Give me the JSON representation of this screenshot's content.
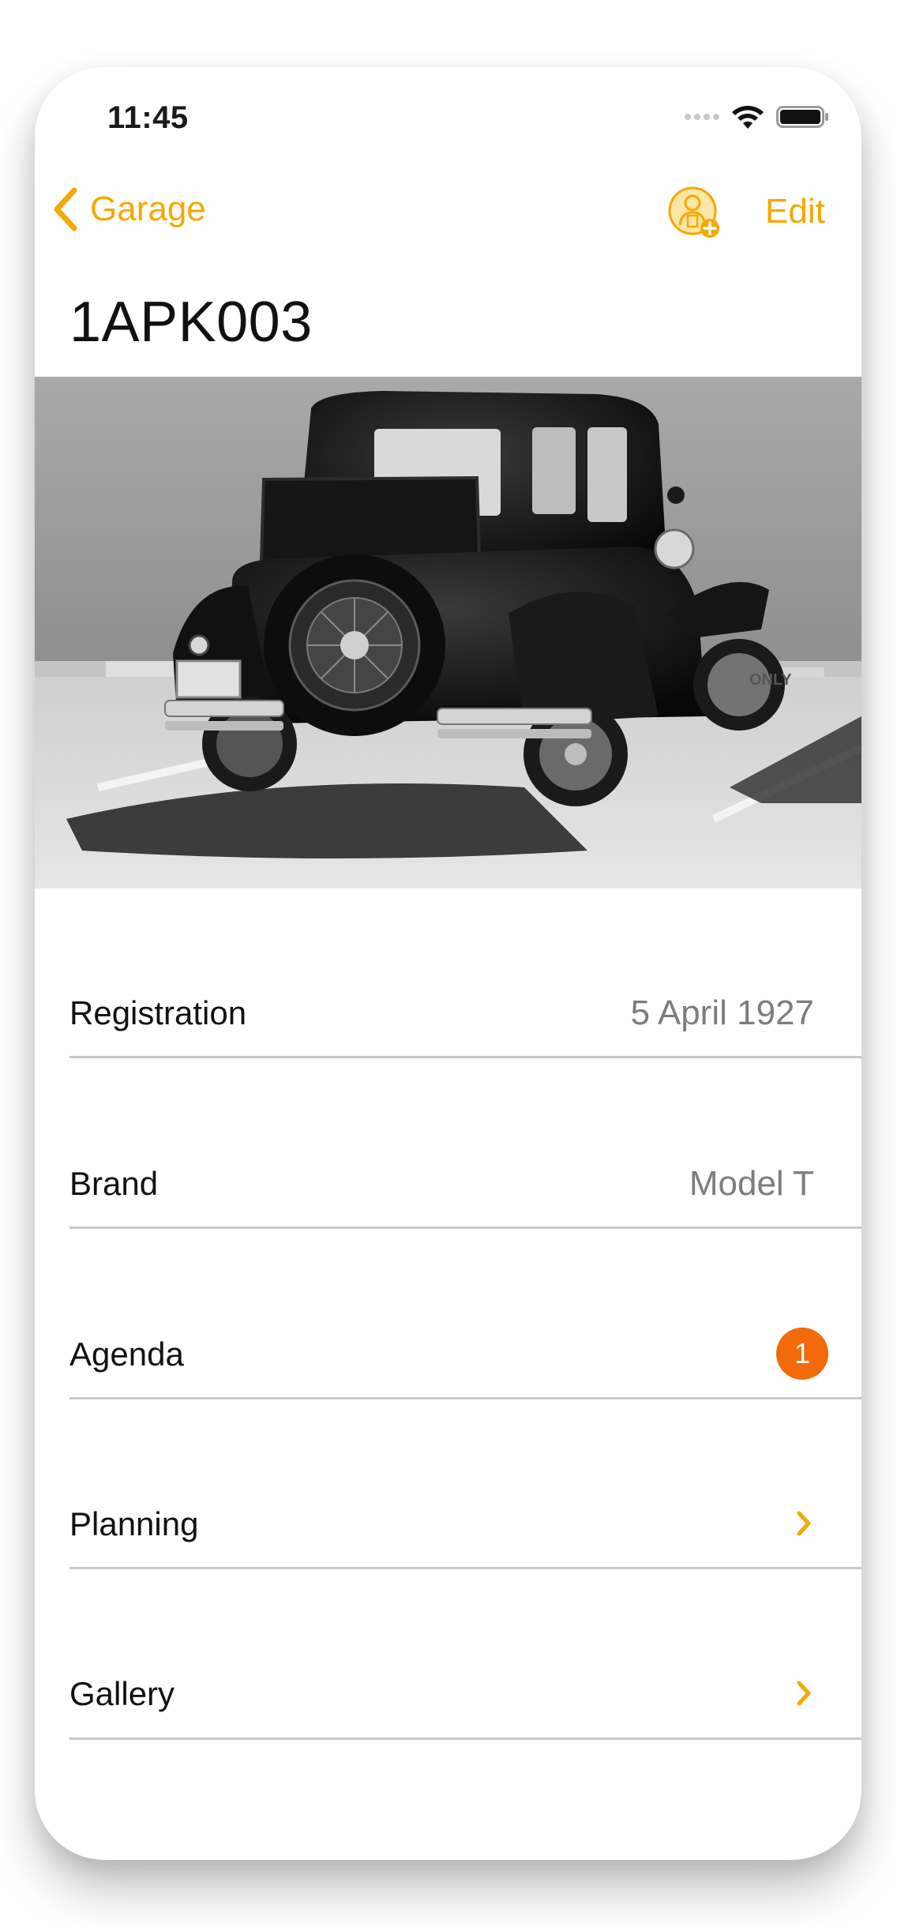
{
  "status_bar": {
    "time": "11:45"
  },
  "nav": {
    "back_label": "Garage",
    "edit_label": "Edit"
  },
  "title": "1APK003",
  "colors": {
    "accent": "#f5a800",
    "badge": "#f26a0a",
    "divider": "#c9c9c9",
    "secondary_text": "#7d7d7d"
  },
  "rows": [
    {
      "label": "Registration",
      "value": "5 April 1927"
    },
    {
      "label": "Brand",
      "value": "Model T"
    },
    {
      "label": "Agenda",
      "badge": "1"
    },
    {
      "label": "Planning"
    },
    {
      "label": "Gallery"
    }
  ],
  "hero_image": {
    "number_plate_text": "ONLY"
  },
  "icons": {
    "back": "chevron-left-icon",
    "add_person": "add-person-icon",
    "disclosure": "chevron-right-icon",
    "wifi": "wifi-icon",
    "battery": "battery-icon"
  }
}
